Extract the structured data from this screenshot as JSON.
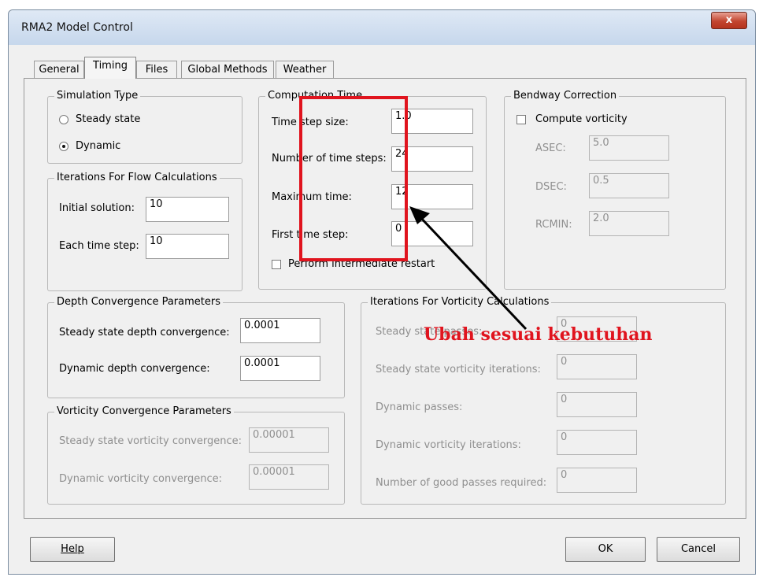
{
  "window": {
    "title": "RMA2 Model Control",
    "close_glyph": "x"
  },
  "tabs": [
    {
      "label": "General",
      "active": false
    },
    {
      "label": "Timing",
      "active": true
    },
    {
      "label": "Files",
      "active": false
    },
    {
      "label": "Global Methods",
      "active": false
    },
    {
      "label": "Weather",
      "active": false
    }
  ],
  "simulation_type": {
    "legend": "Simulation Type",
    "options": [
      {
        "label": "Steady state",
        "selected": false
      },
      {
        "label": "Dynamic",
        "selected": true
      }
    ]
  },
  "iterations_flow": {
    "legend": "Iterations For Flow Calculations",
    "initial_label": "Initial solution:",
    "initial_value": "10",
    "each_label": "Each time step:",
    "each_value": "10"
  },
  "computation_time": {
    "legend": "Computation Time",
    "step_size_label": "Time step size:",
    "step_size_value": "1.0",
    "num_steps_label": "Number of time steps:",
    "num_steps_value": "24",
    "max_time_label": "Maximum time:",
    "max_time_value": "12",
    "first_step_label": "First time step:",
    "first_step_value": "0",
    "restart_label": "Perform intermediate restart",
    "restart_checked": false
  },
  "bendway": {
    "legend": "Bendway Correction",
    "compute_label": "Compute vorticity",
    "compute_checked": false,
    "asec_label": "ASEC:",
    "asec_value": "5.0",
    "dsec_label": "DSEC:",
    "dsec_value": "0.5",
    "rcmin_label": "RCMIN:",
    "rcmin_value": "2.0"
  },
  "depth_convergence": {
    "legend": "Depth Convergence Parameters",
    "steady_label": "Steady state depth convergence:",
    "steady_value": "0.0001",
    "dynamic_label": "Dynamic depth convergence:",
    "dynamic_value": "0.0001"
  },
  "vorticity_convergence": {
    "legend": "Vorticity Convergence Parameters",
    "steady_label": "Steady state vorticity convergence:",
    "steady_value": "0.00001",
    "dynamic_label": "Dynamic vorticity convergence:",
    "dynamic_value": "0.00001"
  },
  "iterations_vorticity": {
    "legend": "Iterations For Vorticity Calculations",
    "steady_passes_label": "Steady state passes:",
    "steady_passes_value": "0",
    "steady_iter_label": "Steady state vorticity iterations:",
    "steady_iter_value": "0",
    "dyn_passes_label": "Dynamic passes:",
    "dyn_passes_value": "0",
    "dyn_iter_label": "Dynamic vorticity iterations:",
    "dyn_iter_value": "0",
    "good_passes_label": "Number of good passes required:",
    "good_passes_value": "0"
  },
  "buttons": {
    "help": "Help",
    "ok": "OK",
    "cancel": "Cancel"
  },
  "annotation": {
    "text": "Ubah sesuai kebutuhan",
    "color": "#e0141e"
  }
}
